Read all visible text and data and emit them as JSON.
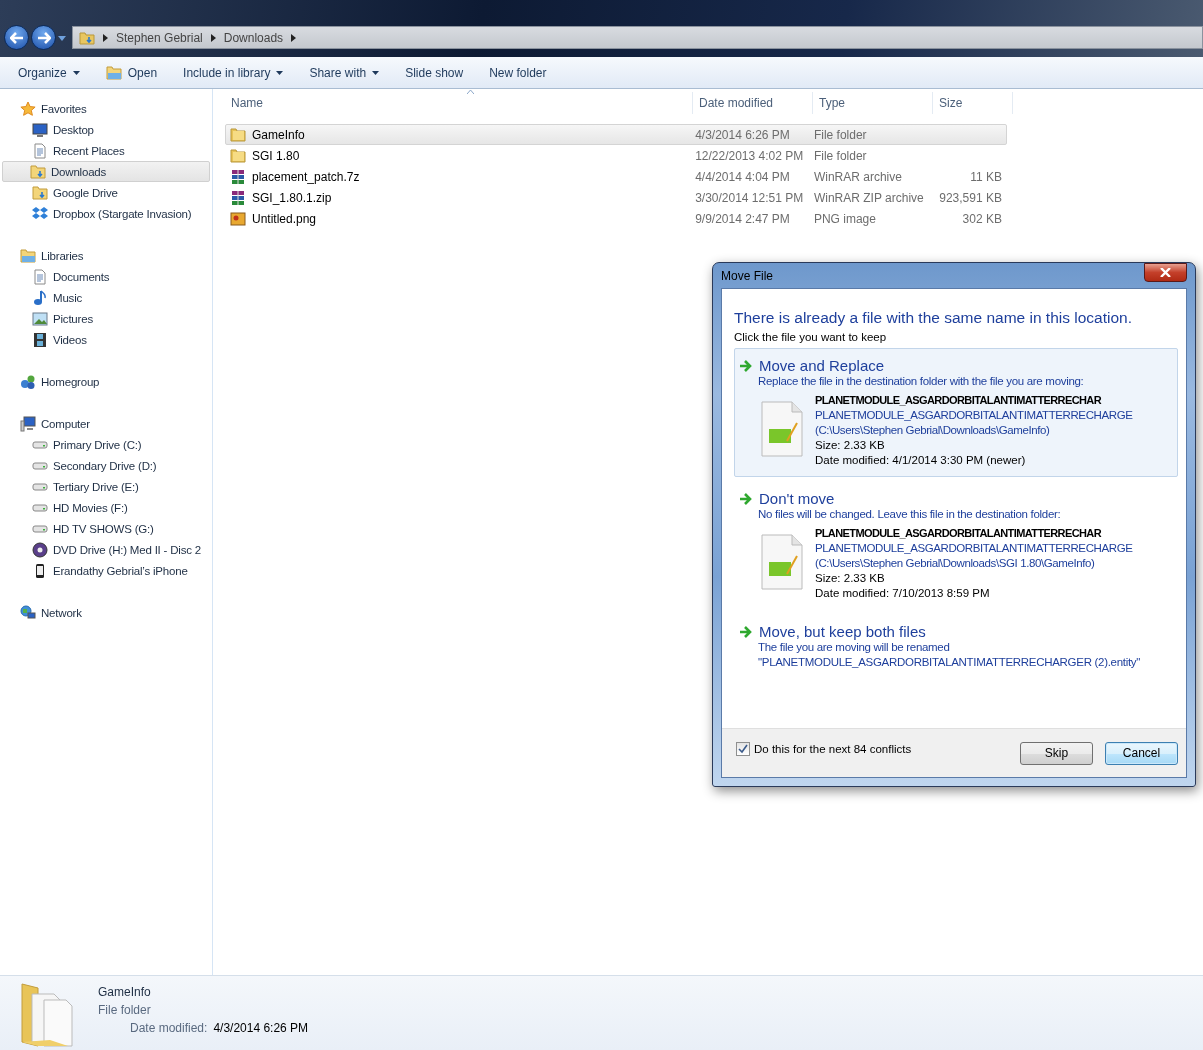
{
  "address_bar": {
    "segments": [
      "Stephen Gebrial",
      "Downloads"
    ]
  },
  "toolbar": [
    {
      "label": "Organize",
      "kind": "menu"
    },
    {
      "label": "Open",
      "kind": "icon"
    },
    {
      "label": "Include in library",
      "kind": "menu"
    },
    {
      "label": "Share with",
      "kind": "menu"
    },
    {
      "label": "Slide show",
      "kind": "plain"
    },
    {
      "label": "New folder",
      "kind": "plain"
    }
  ],
  "sidebar": {
    "groups": [
      {
        "label": "Favorites",
        "kind": "star",
        "children": [
          {
            "label": "Desktop",
            "kind": "monitor",
            "selected": false
          },
          {
            "label": "Recent Places",
            "kind": "document",
            "selected": false
          },
          {
            "label": "Downloads",
            "kind": "folder",
            "selected": true
          },
          {
            "label": "Google Drive",
            "kind": "folder",
            "selected": false
          },
          {
            "label": "Dropbox (Stargate Invasion)",
            "kind": "diamond",
            "selected": false
          }
        ]
      },
      {
        "label": "Libraries",
        "kind": "folder",
        "children": [
          {
            "label": "Documents",
            "kind": "document",
            "selected": false
          },
          {
            "label": "Music",
            "kind": "note",
            "selected": false
          },
          {
            "label": "Pictures",
            "kind": "picture",
            "selected": false
          },
          {
            "label": "Videos",
            "kind": "film",
            "selected": false
          }
        ]
      },
      {
        "label": "Homegroup",
        "kind": "circles"
      },
      {
        "label": "Computer",
        "kind": "monitor",
        "children": [
          {
            "label": "Primary Drive (C:)",
            "kind": "drive",
            "selected": false
          },
          {
            "label": "Secondary Drive (D:)",
            "kind": "drive",
            "selected": false
          },
          {
            "label": "Tertiary Drive (E:)",
            "kind": "drive",
            "selected": false
          },
          {
            "label": "HD Movies (F:)",
            "kind": "drive",
            "selected": false
          },
          {
            "label": "HD TV SHOWS (G:)",
            "kind": "drive",
            "selected": false
          },
          {
            "label": "DVD Drive (H:) Med II - Disc 2",
            "kind": "disc",
            "selected": false
          },
          {
            "label": "Erandathy Gebrial’s iPhone",
            "kind": "phone",
            "selected": false
          }
        ]
      },
      {
        "label": "Network",
        "kind": "globe"
      }
    ]
  },
  "file_list": {
    "columns": [
      "Name",
      "Date modified",
      "Type",
      "Size"
    ],
    "rows": [
      {
        "name": "GameInfo",
        "date": "4/3/2014 6:26 PM",
        "type": "File folder",
        "kind": "folder",
        "selected": true
      },
      {
        "name": "SGI 1.80",
        "date": "12/22/2013 4:02 PM",
        "type": "File folder",
        "kind": "folder",
        "selected": false
      },
      {
        "name": "placement_patch.7z",
        "date": "4/4/2014 4:04 PM",
        "type": "WinRAR archive",
        "size": "11 KB",
        "kind": "archive",
        "selected": false
      },
      {
        "name": "SGI_1.80.1.zip",
        "date": "3/30/2014 12:51 PM",
        "type": "WinRAR ZIP archive",
        "size": "923,591 KB",
        "kind": "archive",
        "selected": false
      },
      {
        "name": "Untitled.png",
        "date": "9/9/2014 2:47 PM",
        "type": "PNG image",
        "size": "302 KB",
        "kind": "image",
        "selected": false
      }
    ]
  },
  "dialog": {
    "title": "Move File",
    "heading": "There is already a file with the same name in this location.",
    "subheading": "Click the file you want to keep",
    "options": [
      {
        "title": "Move and Replace",
        "description": "Replace the file in the destination folder with the file you are moving:",
        "highlighted": true,
        "file": {
          "name": "PLANETMODULE_ASGARDORBITALANTIMATTERRECHAR",
          "name_full": "PLANETMODULE_ASGARDORBITALANTIMATTERRECHARGE",
          "path": "(C:\\Users\\Stephen Gebrial\\Downloads\\GameInfo)",
          "size": "Size: 2.33 KB",
          "date": "Date modified: 4/1/2014 3:30 PM (newer)"
        }
      },
      {
        "title": "Don't move",
        "description": "No files will be changed. Leave this file in the destination folder:",
        "highlighted": false,
        "file": {
          "name": "PLANETMODULE_ASGARDORBITALANTIMATTERRECHAR",
          "name_full": "PLANETMODULE_ASGARDORBITALANTIMATTERRECHARGE",
          "path": "(C:\\Users\\Stephen Gebrial\\Downloads\\SGI 1.80\\GameInfo)",
          "size": "Size: 2.33 KB",
          "date": "Date modified: 7/10/2013 8:59 PM"
        }
      },
      {
        "title": "Move, but keep both files",
        "description": "The file you are moving will be renamed",
        "detail": "\"PLANETMODULE_ASGARDORBITALANTIMATTERRECHARGER (2).entity\"",
        "highlighted": false
      }
    ],
    "checkbox": {
      "label": "Do this for the next 84 conflicts",
      "checked": true
    },
    "buttons": [
      {
        "label": "Skip",
        "default": false
      },
      {
        "label": "Cancel",
        "default": true
      }
    ]
  },
  "details_pane": {
    "name": "GameInfo",
    "type": "File folder",
    "date_label": "Date modified:",
    "date_value": "4/3/2014 6:26 PM"
  }
}
